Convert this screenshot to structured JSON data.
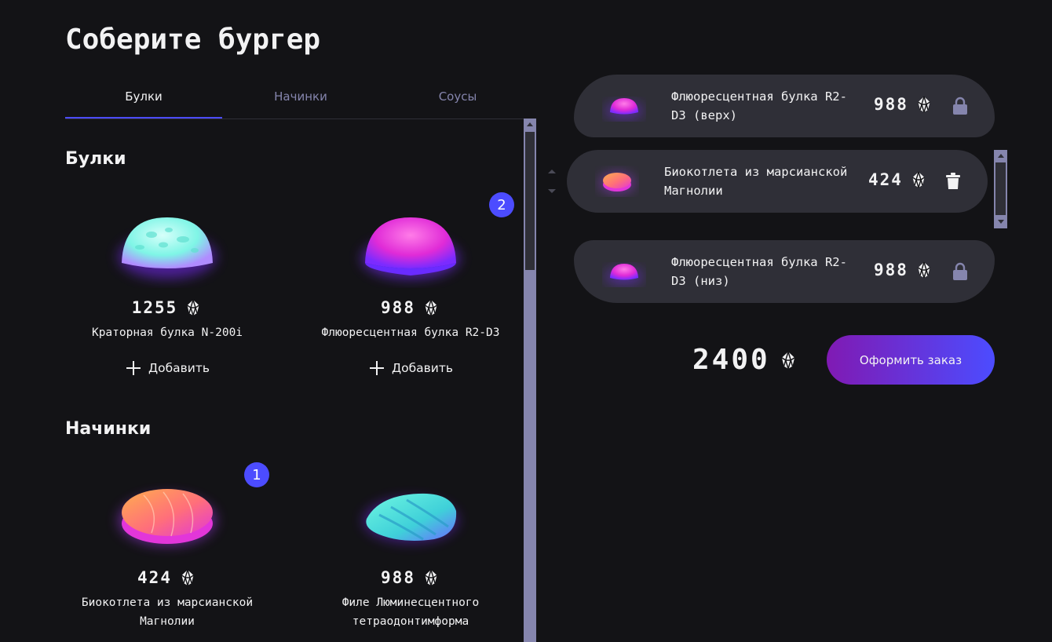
{
  "page_title": "Соберите бургер",
  "tabs": [
    {
      "label": "Булки",
      "active": true
    },
    {
      "label": "Начинки",
      "active": false
    },
    {
      "label": "Соусы",
      "active": false
    }
  ],
  "sections": {
    "buns": {
      "title": "Булки",
      "items": [
        {
          "price": "1255",
          "name": "Краторная булка N-200i",
          "add_label": "Добавить",
          "count": null
        },
        {
          "price": "988",
          "name": "Флюоресцентная булка R2-D3",
          "add_label": "Добавить",
          "count": "2"
        }
      ]
    },
    "mains": {
      "title": "Начинки",
      "items": [
        {
          "price": "424",
          "name": "Биокотлета из марсианской Магнолии",
          "count": "1"
        },
        {
          "price": "988",
          "name": "Филе Люминесцентного тетраодонтимформа",
          "count": null
        }
      ]
    }
  },
  "constructor": {
    "top": {
      "name": "Флюоресцентная булка R2-D3 (верх)",
      "price": "988",
      "icon": "lock-icon"
    },
    "middle": [
      {
        "name": "Биокотлета из марсианской Магнолии",
        "price": "424",
        "icon": "trash-icon"
      }
    ],
    "bottom": {
      "name": "Флюоресцентная булка R2-D3 (низ)",
      "price": "988",
      "icon": "lock-icon"
    }
  },
  "total": "2400",
  "order_button": "Оформить заказ",
  "colors": {
    "background": "#131316",
    "card": "#2f2f37",
    "accent": "#4c4cff",
    "inactive": "#8585ad"
  }
}
